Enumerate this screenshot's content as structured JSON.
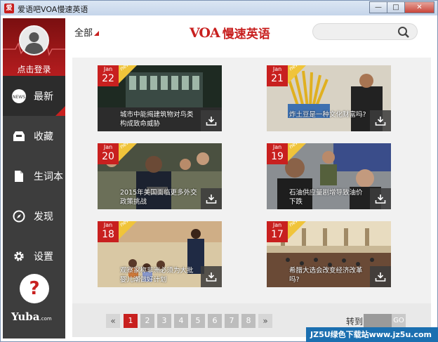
{
  "window": {
    "title": "爱语吧VOA慢速英语",
    "minimize": "—",
    "maximize": "□",
    "close": "✕"
  },
  "sidebar": {
    "login_label": "点击登录",
    "items": [
      {
        "label": "最新",
        "icon": "news-icon"
      },
      {
        "label": "收藏",
        "icon": "inbox-icon"
      },
      {
        "label": "生词本",
        "icon": "book-icon"
      },
      {
        "label": "发现",
        "icon": "compass-icon"
      },
      {
        "label": "设置",
        "icon": "gear-icon"
      }
    ],
    "help": "?",
    "brand": "Yuba",
    "brand_sub": ".com"
  },
  "header": {
    "filter_label": "全部",
    "logo_mark": "VOA",
    "logo_text": "慢速英语"
  },
  "articles": [
    {
      "month": "Jan",
      "day": "22",
      "tag": "new",
      "caption": "城市中能揭建筑物对鸟类构成致命威胁"
    },
    {
      "month": "Jan",
      "day": "21",
      "tag": "new",
      "caption": "炸土豆是一种文化财富吗?"
    },
    {
      "month": "Jan",
      "day": "20",
      "tag": "new",
      "caption": "2015年美国面临更多外交政策挑战"
    },
    {
      "month": "Jan",
      "day": "19",
      "tag": "new",
      "caption": "石油供应量剧增导致油价下跌"
    },
    {
      "month": "Jan",
      "day": "18",
      "tag": "new",
      "caption": "观察家称非洲必须为大批婴儿潮做好计划"
    },
    {
      "month": "Jan",
      "day": "17",
      "tag": "new",
      "caption": "希腊大选会改变经济改革吗?"
    }
  ],
  "pagination": {
    "prev": "«",
    "pages": [
      "1",
      "2",
      "3",
      "4",
      "5",
      "6",
      "7",
      "8"
    ],
    "current": "1",
    "next": "»",
    "goto_label": "转到",
    "go": "GO"
  },
  "watermark": "JZ5U绿色下载站www.jz5u.com",
  "colors": {
    "accent": "#c8201f",
    "sidebar": "#3d3d3d",
    "new_tag": "#f0c43a"
  }
}
